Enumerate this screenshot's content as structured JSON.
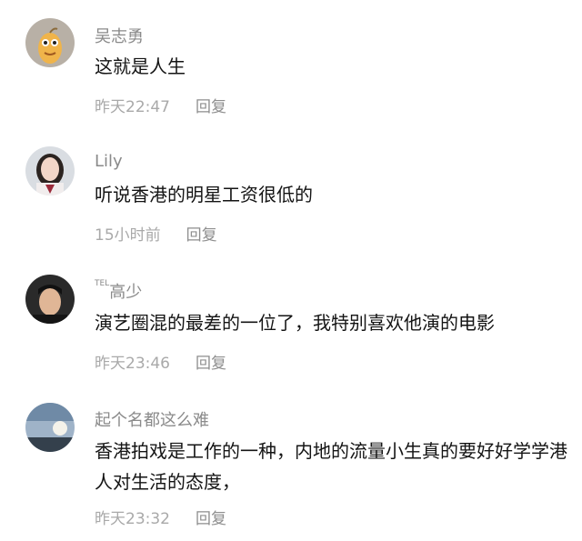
{
  "comments": [
    {
      "username": "吴志勇",
      "badge": "",
      "text": "这就是人生",
      "time": "昨天22:47",
      "reply_label": "回复"
    },
    {
      "username": "Lily",
      "badge": "",
      "text": "听说香港的明星工资很低的",
      "time": "15小时前",
      "reply_label": "回复"
    },
    {
      "username": "高少",
      "badge": "TEL",
      "text": "演艺圈混的最差的一位了，我特别喜欢他演的电影",
      "time": "昨天23:46",
      "reply_label": "回复"
    },
    {
      "username": "起个名都这么难",
      "badge": "",
      "text": "香港拍戏是工作的一种，内地的流量小生真的要好好学学港人对生活的态度，",
      "time": "昨天23:32",
      "reply_label": "回复"
    }
  ]
}
